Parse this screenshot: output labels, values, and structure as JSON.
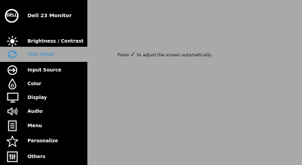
{
  "header": {
    "logo_text": "DÉLL",
    "model": "Dell 23 Monitor"
  },
  "menu": {
    "items": [
      {
        "label": "Brightness / Contrast",
        "icon": "brightness-icon"
      },
      {
        "label": "Auto Adjust",
        "icon": "auto-adjust-icon",
        "active": true
      },
      {
        "label": "Input Source",
        "icon": "input-source-icon"
      },
      {
        "label": "Color",
        "icon": "color-icon"
      },
      {
        "label": "Display",
        "icon": "display-icon"
      },
      {
        "label": "Audio",
        "icon": "audio-icon"
      },
      {
        "label": "Menu",
        "icon": "menu-icon"
      },
      {
        "label": "Personalize",
        "icon": "personalize-icon"
      },
      {
        "label": "Others",
        "icon": "others-icon"
      }
    ]
  },
  "main": {
    "message_before": "Press",
    "check_glyph": "✓",
    "message_after": "to adjust the screen automatically."
  },
  "colors": {
    "sidebar_bg": "#000000",
    "panel_bg": "#a9a9a9",
    "active_text": "#2f8fd5",
    "text": "#ffffff"
  }
}
